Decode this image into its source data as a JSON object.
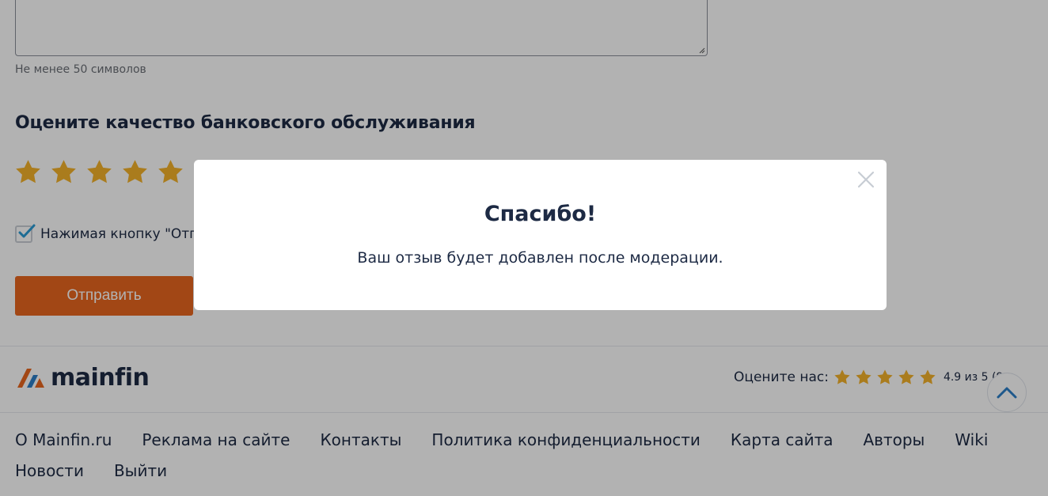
{
  "review_form": {
    "textarea_value": "",
    "hint": "Не менее 50 символов",
    "rating_title": "Оцените качество банковского обслуживания",
    "rating_value": 5,
    "rating_max": 5,
    "consent_checked": true,
    "consent_text": "Нажимая кнопку \"Отправить\"",
    "submit_label": "Отправить"
  },
  "footer": {
    "logo_text": "mainfin",
    "rate_us_label": "Оцените нас:",
    "rate_us_stars": 5,
    "rate_us_score": "4.9 из 5 (9",
    "links": [
      {
        "label": "О Mainfin.ru"
      },
      {
        "label": "Реклама на сайте"
      },
      {
        "label": "Контакты"
      },
      {
        "label": "Политика конфиденциальности"
      },
      {
        "label": "Карта сайта"
      },
      {
        "label": "Авторы"
      },
      {
        "label": "Wiki"
      },
      {
        "label": "Новости"
      },
      {
        "label": "Выйти"
      }
    ]
  },
  "modal": {
    "title": "Спасибо!",
    "message": "Ваш отзыв будет добавлен после модерации."
  },
  "colors": {
    "accent_orange": "#e8661f",
    "star_gold": "#f4b22a",
    "text_dark": "#1d2a44",
    "check_blue": "#2a9bd4",
    "logo_blue": "#2c7fc7"
  },
  "icons": {
    "close": "close-icon",
    "scroll_top": "chevron-up-icon",
    "star": "star-icon",
    "check": "checkmark-icon"
  }
}
